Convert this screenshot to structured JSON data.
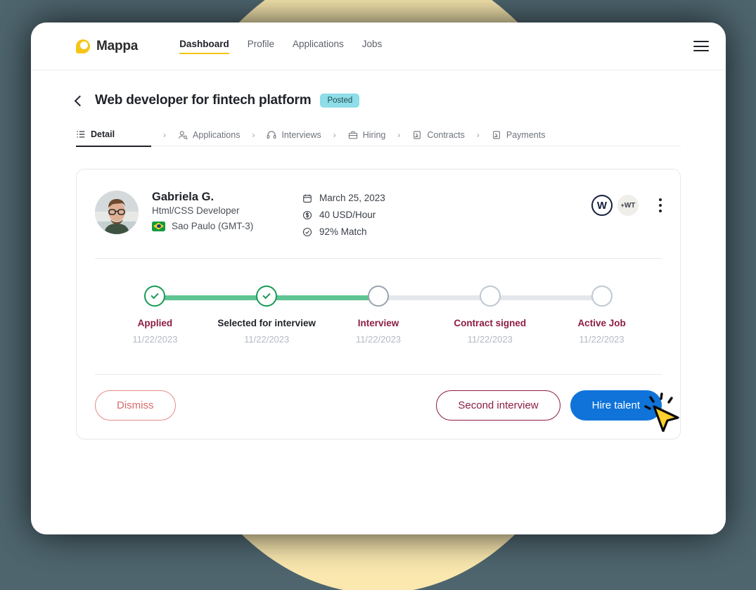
{
  "navbar": {
    "brand": "Mappa",
    "brand_icon": "mappa-logo-icon",
    "menu_icon": "hamburger-menu-icon",
    "links": [
      {
        "label": "Dashboard",
        "active": true
      },
      {
        "label": "Profile",
        "active": false
      },
      {
        "label": "Applications",
        "active": false
      },
      {
        "label": "Jobs",
        "active": false
      }
    ]
  },
  "page": {
    "back_icon": "chevron-left-icon",
    "title": "Web developer for fintech platform",
    "status_badge": "Posted"
  },
  "breadcrumb": {
    "separator": "›",
    "steps": [
      {
        "label": "Detail",
        "icon": "list-detail-icon",
        "active": true
      },
      {
        "label": "Applications",
        "icon": "person-search-icon",
        "active": false
      },
      {
        "label": "Interviews",
        "icon": "headset-icon",
        "active": false
      },
      {
        "label": "Hiring",
        "icon": "briefcase-icon",
        "active": false
      },
      {
        "label": "Contracts",
        "icon": "contract-document-icon",
        "active": false
      },
      {
        "label": "Payments",
        "icon": "payment-document-icon",
        "active": false
      }
    ]
  },
  "candidate": {
    "avatar_alt": "candidate-avatar",
    "name": "Gabriela G.",
    "role": "Html/CSS Developer",
    "flag_icon": "brazil-flag-icon",
    "location": "Sao Paulo (GMT-3)",
    "facts": [
      {
        "icon": "calendar-icon",
        "text": "March 25, 2023"
      },
      {
        "icon": "dollar-circle-icon",
        "text": "40 USD/Hour"
      },
      {
        "icon": "check-circle-icon",
        "text": "92% Match"
      }
    ],
    "company_logo": "volkswagen-logo-icon",
    "company_logo_text": "W",
    "secondary_logo": "wt-logo-icon",
    "secondary_logo_prefix": "+",
    "secondary_logo_text": "WT",
    "more_menu_icon": "kebab-menu-icon"
  },
  "stepper": {
    "steps": [
      {
        "label": "Applied",
        "date": "11/22/2023",
        "state": "done"
      },
      {
        "label": "Selected for interview",
        "date": "11/22/2023",
        "state": "done"
      },
      {
        "label": "Interview",
        "date": "11/22/2023",
        "state": "current"
      },
      {
        "label": "Contract signed",
        "date": "11/22/2023",
        "state": "todo"
      },
      {
        "label": "Active Job",
        "date": "11/22/2023",
        "state": "todo"
      }
    ]
  },
  "actions": {
    "dismiss": "Dismiss",
    "second_interview": "Second interview",
    "hire": "Hire talent",
    "cursor_icon": "mouse-pointer-click-icon"
  },
  "colors": {
    "brand_yellow": "#F5C518",
    "badge_cyan": "#8EDDE8",
    "progress_green": "#5FC392",
    "maroon": "#8C1D43",
    "primary_blue": "#0F73D9",
    "dismiss_red": "#D96A6A",
    "backdrop": "#4E656E",
    "circle_yellow": "#FAE8AF"
  }
}
